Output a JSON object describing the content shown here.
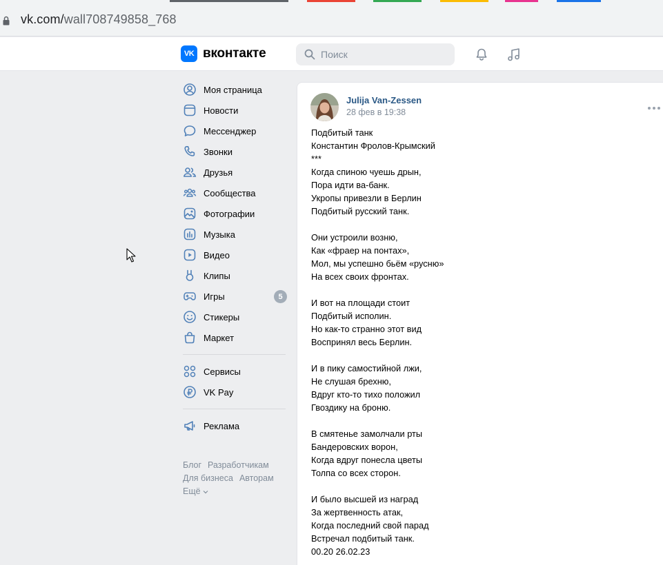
{
  "browser": {
    "url_host": "vk.com/",
    "url_path": "wall708749858_768",
    "tab_colors": [
      "#5f6368",
      "#ea4335",
      "#34a853",
      "#fbbc04",
      "#e8338f",
      "#1a73e8"
    ]
  },
  "header": {
    "logo_text": "вконтакте",
    "logo_mark": "VK",
    "search_placeholder": "Поиск",
    "brand_color": "#0077ff"
  },
  "sidebar": {
    "items": [
      {
        "label": "Моя страница",
        "icon": "user-circle-icon"
      },
      {
        "label": "Новости",
        "icon": "newsfeed-icon"
      },
      {
        "label": "Мессенджер",
        "icon": "message-icon"
      },
      {
        "label": "Звонки",
        "icon": "phone-icon"
      },
      {
        "label": "Друзья",
        "icon": "friends-icon"
      },
      {
        "label": "Сообщества",
        "icon": "communities-icon"
      },
      {
        "label": "Фотографии",
        "icon": "photo-icon"
      },
      {
        "label": "Музыка",
        "icon": "music-icon"
      },
      {
        "label": "Видео",
        "icon": "video-icon"
      },
      {
        "label": "Клипы",
        "icon": "clips-icon"
      },
      {
        "label": "Игры",
        "icon": "gamepad-icon",
        "badge": "5"
      },
      {
        "label": "Стикеры",
        "icon": "smile-icon"
      },
      {
        "label": "Маркет",
        "icon": "market-bag-icon"
      }
    ],
    "items2": [
      {
        "label": "Сервисы",
        "icon": "services-icon"
      },
      {
        "label": "VK Pay",
        "icon": "vkpay-icon"
      }
    ],
    "items3": [
      {
        "label": "Реклама",
        "icon": "megaphone-icon"
      }
    ],
    "footer": {
      "blog": "Блог",
      "developers": "Разработчикам",
      "business": "Для бизнеса",
      "authors": "Авторам",
      "more": "Ещё"
    }
  },
  "post": {
    "author": "Julija Van-Zessen",
    "date": "28 фев в 19:38",
    "text": "Подбитый танк\nКонстантин Фролов-Крымский\n***\nКогда спиною чуешь дрын,\nПора идти ва-банк.\nУкропы привезли в Берлин\nПодбитый русский танк.\n\nОни устроили возню,\nКак «фраер на понтах»,\nМол, мы успешно бьём «русню»\nНа всех своих фронтах.\n\nИ вот на площади стоит\nПодбитый исполин.\nНо как-то странно этот вид\nВоспринял весь Берлин.\n\nИ в пику самостийной лжи,\nНе слушая брехню,\nВдруг кто-то тихо положил\nГвоздику на броню.\n\nВ смятенье замолчали рты\nБандеровских ворон,\nКогда вдруг понесла цветы\nТолпа со всех сторон.\n\nИ было высшей из наград\nЗа жертвенность атак,\nКогда последний свой парад\nВстречал подбитый танк.\n00.20 26.02.23"
  }
}
